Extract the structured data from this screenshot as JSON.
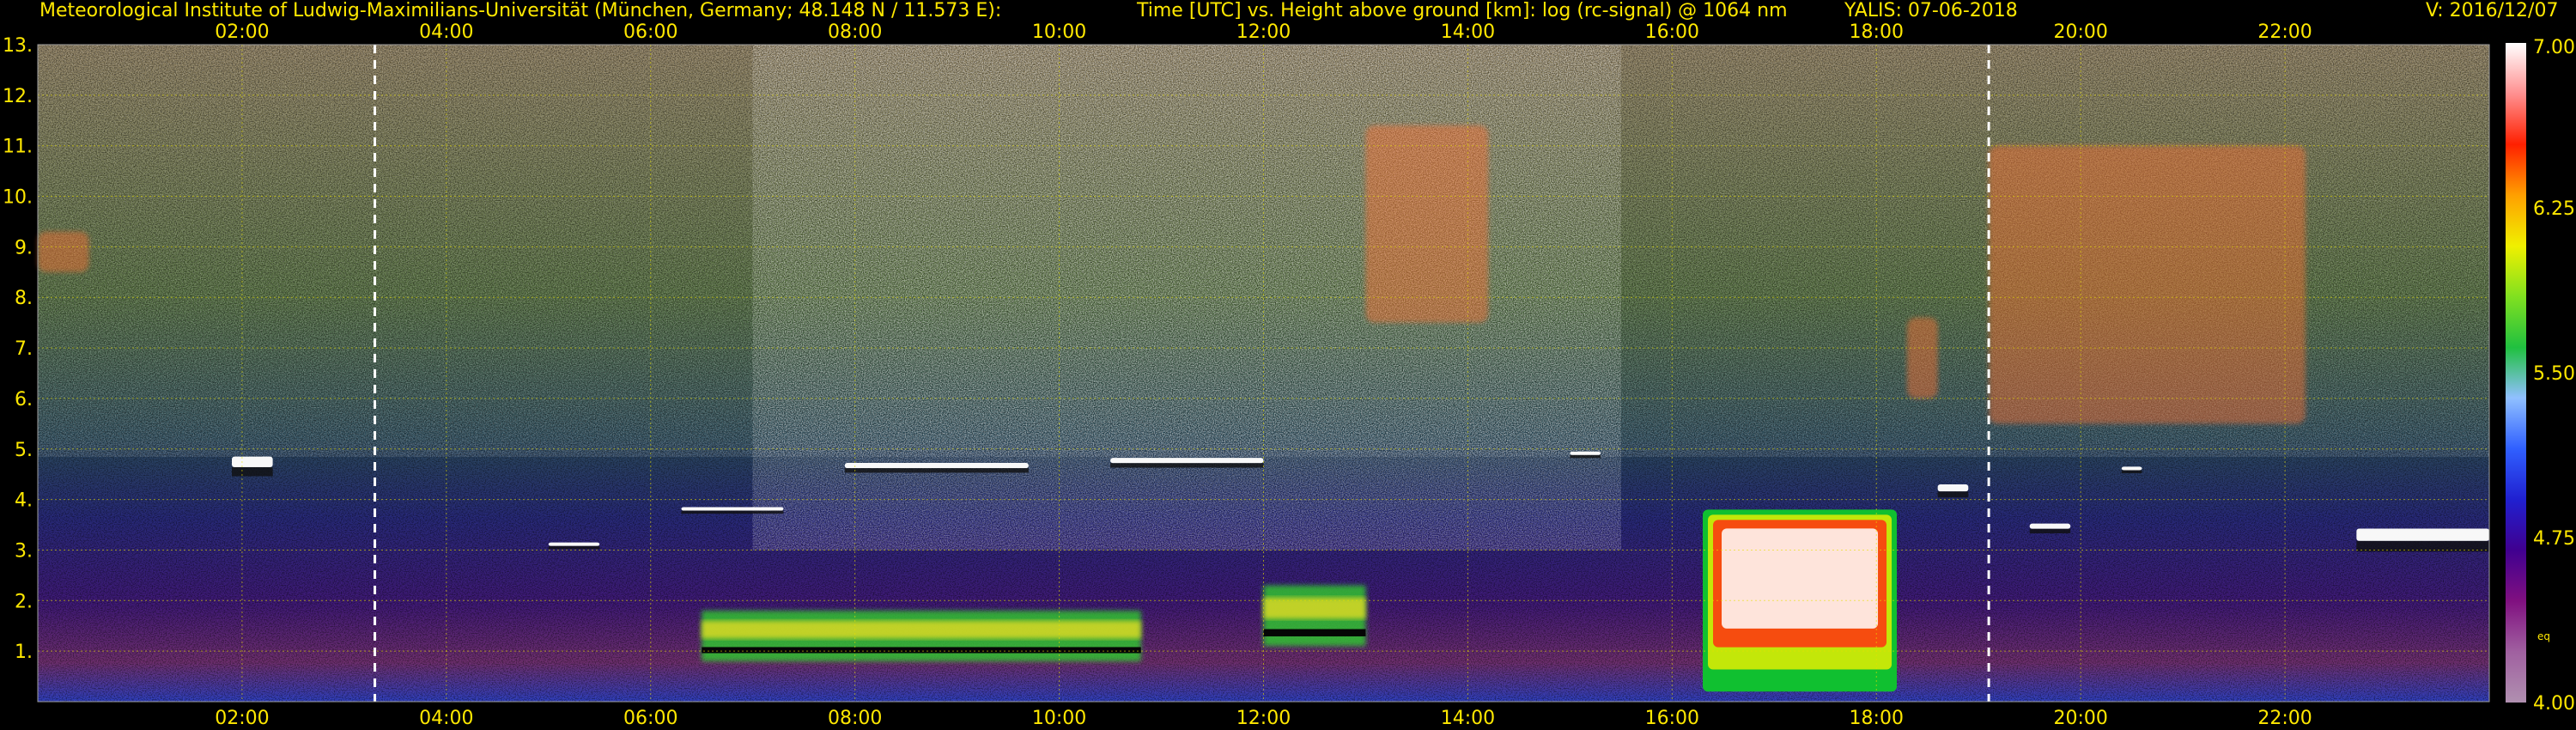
{
  "header": {
    "institute": "Meteorological Institute of Ludwig-Maximilians-Universität (München, Germany; 48.148 N / 11.573 E):",
    "title": "Time [UTC] vs. Height above ground [km]: log (rc-signal) @ 1064 nm",
    "station": "YALIS: 07-06-2018",
    "version": "V: 2016/12/07"
  },
  "chart_data": {
    "type": "heatmap",
    "title": "Time [UTC] vs. Height above ground [km]: log (rc-signal) @ 1064 nm",
    "x_tick_labels": [
      "02:00",
      "04:00",
      "06:00",
      "08:00",
      "10:00",
      "12:00",
      "14:00",
      "16:00",
      "18:00",
      "20:00",
      "22:00"
    ],
    "x_ticks_hours": [
      2,
      4,
      6,
      8,
      10,
      12,
      14,
      16,
      18,
      20,
      22
    ],
    "x_range_hours": [
      0,
      24
    ],
    "y_tick_labels": [
      "1.",
      "2.",
      "3.",
      "4.",
      "5.",
      "6.",
      "7.",
      "8.",
      "9.",
      "10.",
      "11.",
      "12.",
      "13."
    ],
    "y_ticks_km": [
      1,
      2,
      3,
      4,
      5,
      6,
      7,
      8,
      9,
      10,
      11,
      12,
      13
    ],
    "y_range_km": [
      0,
      13
    ],
    "grid": true,
    "colorbar": {
      "range": [
        4.0,
        7.0
      ],
      "tick_labels": [
        "7.00",
        "6.25",
        "5.50",
        "4.75",
        "4.00"
      ],
      "tick_values": [
        7.0,
        6.25,
        5.5,
        4.75,
        4.0
      ],
      "small_label": "eq",
      "colors": [
        "#b090b0",
        "#a060a0",
        "#801080",
        "#400090",
        "#2020d0",
        "#3060ff",
        "#90c0ff",
        "#20c040",
        "#80e020",
        "#f0f000",
        "#ffa000",
        "#ff2000",
        "#ff9090",
        "#ffffff"
      ]
    },
    "dashed_markers_hours": [
      3.3,
      19.1
    ],
    "features": [
      {
        "kind": "cloud_layer",
        "start": 1.9,
        "end": 2.3,
        "km": [
          4.4,
          5.0
        ]
      },
      {
        "kind": "cloud_layer",
        "start": 5.0,
        "end": 5.5,
        "km": [
          3.0,
          3.2
        ]
      },
      {
        "kind": "cloud_layer",
        "start": 6.3,
        "end": 7.3,
        "km": [
          3.7,
          3.9
        ]
      },
      {
        "kind": "cloud_layer",
        "start": 7.9,
        "end": 9.7,
        "km": [
          4.5,
          4.8
        ]
      },
      {
        "kind": "cloud_layer",
        "start": 10.5,
        "end": 12.0,
        "km": [
          4.6,
          4.9
        ]
      },
      {
        "kind": "cloud_layer",
        "start": 15.0,
        "end": 15.3,
        "km": [
          4.8,
          5.0
        ]
      },
      {
        "kind": "cloud_layer",
        "start": 18.6,
        "end": 18.9,
        "km": [
          4.0,
          4.4
        ]
      },
      {
        "kind": "cloud_layer",
        "start": 19.5,
        "end": 19.9,
        "km": [
          3.3,
          3.6
        ]
      },
      {
        "kind": "cloud_layer",
        "start": 20.4,
        "end": 20.6,
        "km": [
          4.5,
          4.7
        ]
      },
      {
        "kind": "cloud_layer",
        "start": 22.7,
        "end": 24.0,
        "km": [
          2.9,
          3.6
        ]
      },
      {
        "kind": "boundary_layer",
        "start": 6.5,
        "end": 10.8,
        "km": [
          0.8,
          1.8
        ]
      },
      {
        "kind": "boundary_layer",
        "start": 12.0,
        "end": 13.0,
        "km": [
          1.1,
          2.3
        ]
      },
      {
        "kind": "convective_cloud",
        "start": 16.3,
        "end": 18.2,
        "km": [
          0.2,
          3.8
        ]
      },
      {
        "kind": "cirrus",
        "start": 13.0,
        "end": 14.2,
        "km": [
          7.5,
          11.4
        ]
      },
      {
        "kind": "cirrus",
        "start": 18.3,
        "end": 18.6,
        "km": [
          6.0,
          7.6
        ]
      },
      {
        "kind": "cirrus",
        "start": 19.1,
        "end": 22.2,
        "km": [
          5.5,
          11.0
        ]
      },
      {
        "kind": "cirrus",
        "start": 0.0,
        "end": 0.5,
        "km": [
          8.5,
          9.3
        ]
      }
    ]
  }
}
